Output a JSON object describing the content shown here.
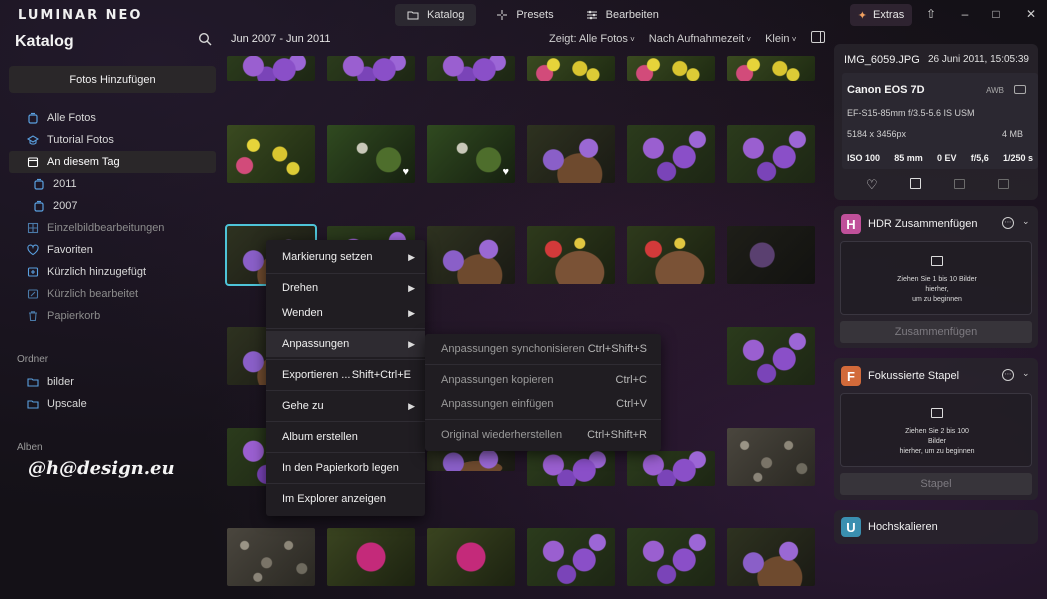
{
  "app": {
    "logo": "LUMINAR NEO",
    "tabs": [
      {
        "label": "Katalog",
        "icon": "folder-icon",
        "active": true
      },
      {
        "label": "Presets",
        "icon": "sparkle-icon",
        "active": false
      },
      {
        "label": "Bearbeiten",
        "icon": "sliders-icon",
        "active": false
      }
    ],
    "extras_label": "Extras",
    "accent_color": "#4ec4d8"
  },
  "sidebar": {
    "title": "Katalog",
    "add_button": "Fotos Hinzufügen",
    "items": [
      {
        "label": "Alle Fotos",
        "icon": "photo-stack-icon"
      },
      {
        "label": "Tutorial Fotos",
        "icon": "graduation-cap-icon"
      },
      {
        "label": "An diesem Tag",
        "icon": "calendar-icon"
      },
      {
        "label": "2011",
        "icon": "photo-stack-icon"
      },
      {
        "label": "2007",
        "icon": "photo-stack-icon"
      },
      {
        "label": "Einzelbildbearbeitungen",
        "icon": "grid-icon"
      },
      {
        "label": "Favoriten",
        "icon": "heart-icon"
      },
      {
        "label": "Kürzlich hinzugefügt",
        "icon": "image-add-icon"
      },
      {
        "label": "Kürzlich bearbeitet",
        "icon": "image-edit-icon"
      },
      {
        "label": "Papierkorb",
        "icon": "trash-icon"
      }
    ],
    "folders_label": "Ordner",
    "folders": [
      {
        "label": "bilder",
        "icon": "folder-icon"
      },
      {
        "label": "Upscale",
        "icon": "folder-icon"
      }
    ],
    "albums_label": "Alben",
    "watermark": "@h@design.eu"
  },
  "grid": {
    "date_range": "Jun 2007 - Jun 2011",
    "filters": [
      "Zeigt: Alle Fotos",
      "Nach Aufnahmezeit",
      "Klein"
    ]
  },
  "context_menu": {
    "items": [
      {
        "label": "Markierung setzen",
        "shortcut": "",
        "arrow": true
      },
      {
        "label": "Drehen",
        "shortcut": "",
        "arrow": true
      },
      {
        "label": "Wenden",
        "shortcut": "",
        "arrow": true
      },
      {
        "label": "Anpassungen",
        "shortcut": "",
        "arrow": true
      },
      {
        "label": "Exportieren ...",
        "shortcut": "Shift+Ctrl+E",
        "arrow": false
      },
      {
        "label": "Gehe zu",
        "shortcut": "",
        "arrow": true
      },
      {
        "label": "Album erstellen",
        "shortcut": "",
        "arrow": false
      },
      {
        "label": "In den Papierkorb legen",
        "shortcut": "",
        "arrow": false
      },
      {
        "label": "Im Explorer anzeigen",
        "shortcut": "",
        "arrow": false
      }
    ],
    "submenu": [
      {
        "label": "Anpassungen synchonisieren",
        "shortcut": "Ctrl+Shift+S"
      },
      {
        "label": "Anpassungen kopieren",
        "shortcut": "Ctrl+C"
      },
      {
        "label": "Anpassungen einfügen",
        "shortcut": "Ctrl+V"
      },
      {
        "label": "Original wiederherstellen",
        "shortcut": "Ctrl+Shift+R"
      }
    ]
  },
  "info": {
    "filename": "IMG_6059.JPG",
    "date": "26 Juni 2011, 15:05:39",
    "camera": "Canon EOS 7D",
    "wb": "AWB",
    "lens": "EF-S15-85mm f/3.5-5.6 IS USM",
    "dimensions": "5184 x 3456px",
    "filesize": "4 MB",
    "exif": [
      "ISO 100",
      "85 mm",
      "0 EV",
      "f/5,6",
      "1/250 s"
    ]
  },
  "tools": [
    {
      "name": "HDR Zusammenfügen",
      "letter": "H",
      "color": "#c0509a",
      "drop_text": [
        "Ziehen Sie 1 bis 10 Bilder",
        "hierher,",
        "um zu beginnen"
      ],
      "button": "Zusammenfügen"
    },
    {
      "name": "Fokussierte Stapel",
      "letter": "F",
      "color": "#d26a3a",
      "drop_text": [
        "Ziehen Sie 2 bis 100",
        "Bilder",
        "hierher, um zu beginnen"
      ],
      "button": "Stapel"
    },
    {
      "name": "Hochskalieren",
      "letter": "U",
      "color": "#3a8fb0"
    }
  ]
}
